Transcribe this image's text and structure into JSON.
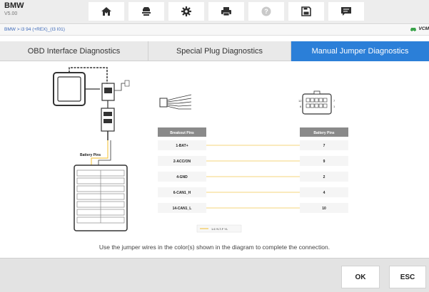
{
  "app": {
    "name": "BMW",
    "version": "V5.00"
  },
  "toolbar": {
    "buttons": [
      {
        "name": "home-button",
        "icon": "home-icon"
      },
      {
        "name": "vehicle-swap-button",
        "icon": "car-swap-icon"
      },
      {
        "name": "settings-button",
        "icon": "gear-icon"
      },
      {
        "name": "print-button",
        "icon": "printer-icon"
      },
      {
        "name": "help-button",
        "icon": "help-icon"
      },
      {
        "name": "save-button",
        "icon": "save-icon"
      },
      {
        "name": "message-button",
        "icon": "message-icon"
      }
    ]
  },
  "breadcrumb": "BMW > i3 94 (+REX)_(I3 I01)",
  "vin_label": "VCM",
  "tabs": [
    {
      "label": "OBD Interface Diagnostics",
      "active": false
    },
    {
      "label": "Special Plug Diagnostics",
      "active": false
    },
    {
      "label": "Manual Jumper Diagnostics",
      "active": true
    }
  ],
  "diagram": {
    "battery_pins_label": "Battery Pins",
    "connector_pin_left_top": "12",
    "connector_pin_left_bottom": "6",
    "connector_pin_right_top": "7",
    "connector_pin_right_bottom": "1",
    "breakout_header": "Breakout Pins",
    "battery_header": "Battery Pins",
    "rows": [
      {
        "breakout": "1-BAT+",
        "battery": "7"
      },
      {
        "breakout": "2-ACC/ON",
        "battery": "9"
      },
      {
        "breakout": "4-GND",
        "battery": "2"
      },
      {
        "breakout": "6-CAN1_H",
        "battery": "4"
      },
      {
        "breakout": "14-CAN1_L",
        "battery": "10"
      }
    ],
    "legend_text": "1.6 YLT-F YL",
    "wire_color": "#f3c74f"
  },
  "instruction": "Use the jumper wires in the color(s) shown in the diagram to complete the connection.",
  "buttons": {
    "ok": "OK",
    "esc": "ESC"
  },
  "colors": {
    "accent": "#2b7fd8",
    "header_gray": "#8a8a8a",
    "wire": "#f3c74f",
    "vehicle_icon": "#3aa34a"
  }
}
